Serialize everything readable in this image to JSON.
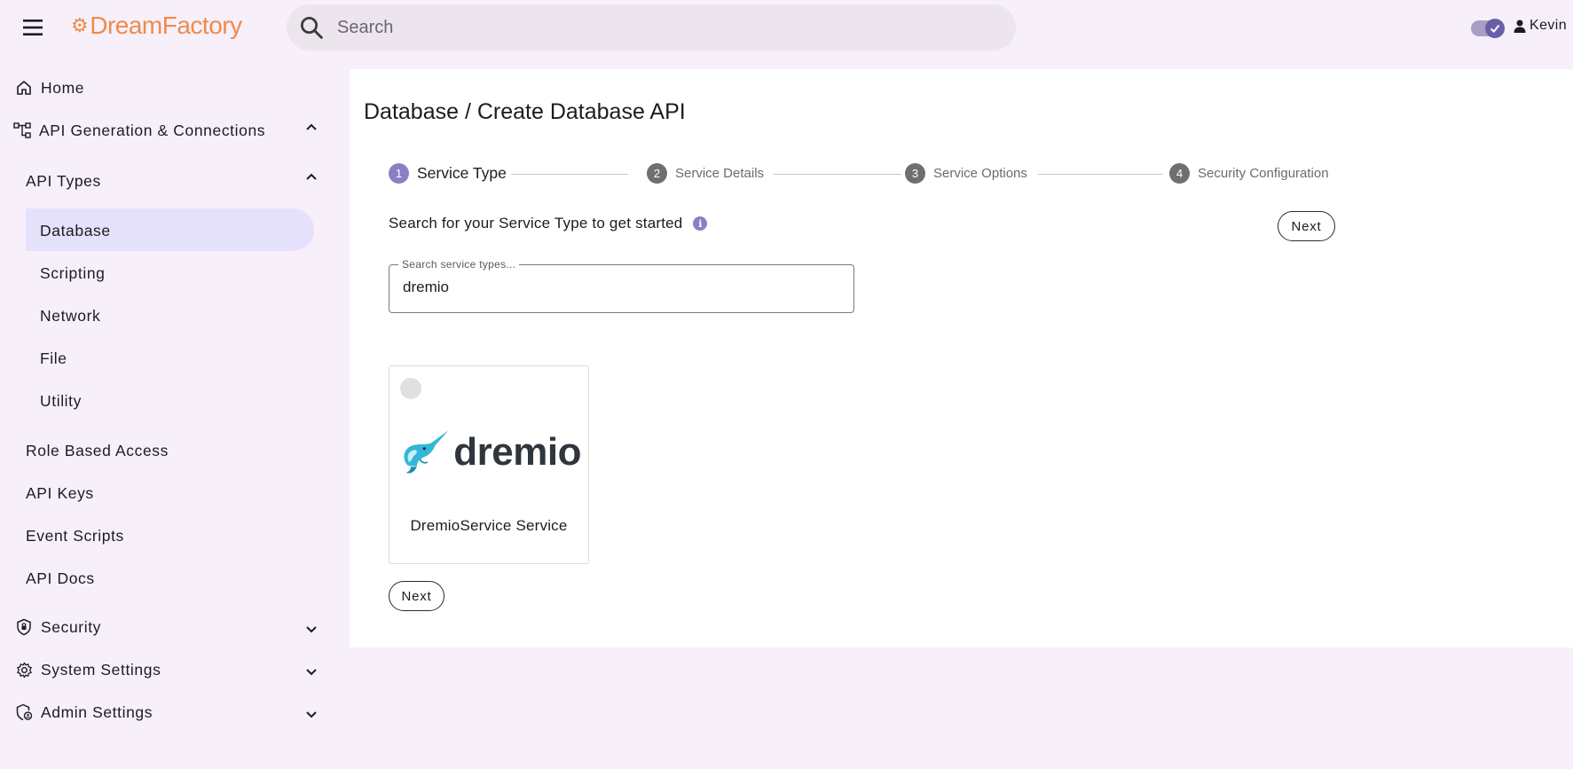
{
  "header": {
    "logo_text": "DreamFactory",
    "search_placeholder": "Search",
    "user_name": "Kevin"
  },
  "sidebar": {
    "home": "Home",
    "api_generation": "API Generation & Connections",
    "api_types": "API Types",
    "api_type_items": [
      "Database",
      "Scripting",
      "Network",
      "File",
      "Utility"
    ],
    "role_based_access": "Role Based Access",
    "api_keys": "API Keys",
    "event_scripts": "Event Scripts",
    "api_docs": "API Docs",
    "security": "Security",
    "system_settings": "System Settings",
    "admin_settings": "Admin Settings"
  },
  "main": {
    "title": "Database / Create Database API",
    "steps": [
      {
        "num": "1",
        "label": "Service Type"
      },
      {
        "num": "2",
        "label": "Service Details"
      },
      {
        "num": "3",
        "label": "Service Options"
      },
      {
        "num": "4",
        "label": "Security Configuration"
      }
    ],
    "prompt": "Search for your Service Type to get started",
    "next_label": "Next",
    "search_field_label": "Search service types...",
    "search_field_value": "dremio",
    "card": {
      "brand": "dremio",
      "label": "DremioService Service"
    }
  },
  "colors": {
    "accent": "#8b7fc4",
    "logo": "#f08a4b",
    "active_nav": "#e6e1fb",
    "background": "#f7f0fa"
  }
}
